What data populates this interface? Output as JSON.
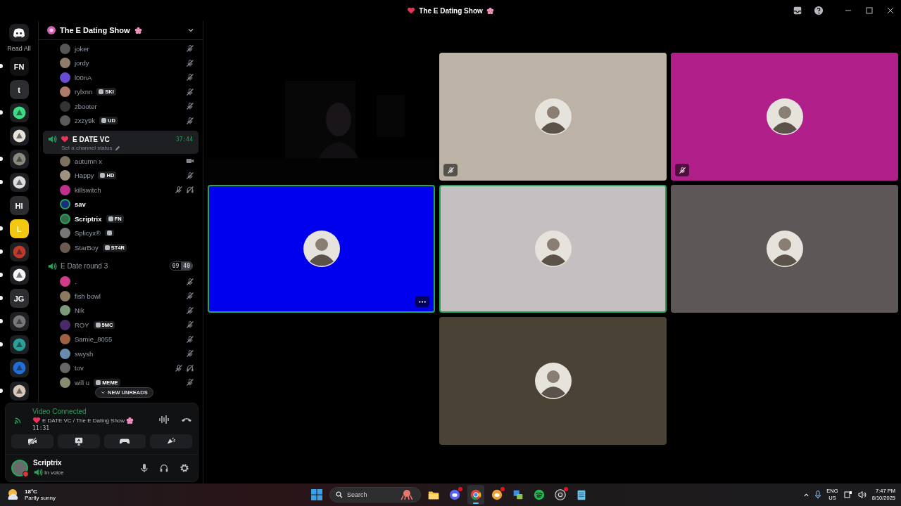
{
  "window": {
    "title": "The E Dating Show"
  },
  "rail": {
    "read_all": "Read All",
    "servers": [
      {
        "kind": "label",
        "label": "FN",
        "color": "#111111",
        "unread": true
      },
      {
        "kind": "label",
        "label": "t",
        "color": "#2b2d31",
        "unread": false
      },
      {
        "kind": "logo",
        "color": "#3ddc84",
        "unread": true
      },
      {
        "kind": "logo",
        "color": "#e8e2d8",
        "unread": false
      },
      {
        "kind": "logo",
        "color": "#8a8a80",
        "unread": true
      },
      {
        "kind": "logo",
        "color": "#dddddd",
        "unread": true
      },
      {
        "kind": "label",
        "label": "HI",
        "color": "#2b2d31",
        "unread": false
      },
      {
        "kind": "label",
        "label": "L",
        "color": "#f2c811",
        "unread": true
      },
      {
        "kind": "logo",
        "color": "#c0392b",
        "unread": true
      },
      {
        "kind": "logo",
        "color": "#f5f5f5",
        "unread": true
      },
      {
        "kind": "label",
        "label": "JG",
        "color": "#2b2d31",
        "unread": true
      },
      {
        "kind": "logo",
        "color": "#777777",
        "unread": true
      },
      {
        "kind": "logo",
        "color": "#2aa198",
        "unread": true
      },
      {
        "kind": "logo",
        "color": "#1e6fd9",
        "unread": false
      },
      {
        "kind": "logo",
        "color": "#d9c7b8",
        "unread": true
      }
    ]
  },
  "server": {
    "name": "The E Dating Show"
  },
  "members_above": [
    {
      "name": "joker",
      "muted": true
    },
    {
      "name": "jordy",
      "muted": true
    },
    {
      "name": "l00nA",
      "muted": true
    },
    {
      "name": "rylxnn",
      "tag": "SKI",
      "muted": true
    },
    {
      "name": "zbooter",
      "muted": true
    },
    {
      "name": "zxzy9k",
      "tag": "UD",
      "muted": true
    }
  ],
  "channels": [
    {
      "name": "E DATE VC",
      "selected": true,
      "timer": "37:44",
      "status": "Set a channel status",
      "members": [
        {
          "name": "autumn x",
          "video": true
        },
        {
          "name": "Happy",
          "tag": "HD",
          "muted": true
        },
        {
          "name": "killswitch",
          "muted": true,
          "deafened": true
        },
        {
          "name": "sav",
          "speaking": true
        },
        {
          "name": "Scriptrix",
          "tag": "FN",
          "speaking": true
        },
        {
          "name": "Splicyx®",
          "tag_icon_only": true
        },
        {
          "name": "StarBoy",
          "tag": "ST4R"
        }
      ]
    },
    {
      "name": "E Date round 3",
      "selected": false,
      "user_count": "09",
      "user_limit": "40",
      "members": [
        {
          "name": ".",
          "muted": true
        },
        {
          "name": "fish bowl",
          "muted": true
        },
        {
          "name": "Nik",
          "muted": true
        },
        {
          "name": "ROY",
          "tag": "5MC",
          "muted": true
        },
        {
          "name": "Samie_8055",
          "muted": true
        },
        {
          "name": "swysh",
          "muted": true
        },
        {
          "name": "tov",
          "muted": true,
          "deafened": true
        },
        {
          "name": "will u",
          "tag": "MEME",
          "muted": true
        }
      ]
    }
  ],
  "new_unreads": "NEW UNREADS",
  "voice_panel": {
    "status": "Video Connected",
    "location": "E DATE VC / The E Dating Show",
    "elapsed": "11:31"
  },
  "user_panel": {
    "name": "Scriptrix",
    "status": "In voice"
  },
  "tiles": [
    {
      "kind": "video"
    },
    {
      "kind": "avatar",
      "color": "#bcb3a6",
      "muted": true
    },
    {
      "kind": "avatar",
      "color": "#b01f8a",
      "muted": true
    },
    {
      "kind": "avatar",
      "color": "#0000ee",
      "speaking": true,
      "menu": true
    },
    {
      "kind": "avatar",
      "color": "#c4bfc0",
      "speaking": true
    },
    {
      "kind": "avatar",
      "color": "#5d5757"
    },
    {
      "kind": "avatar",
      "color": "#4a4235"
    }
  ],
  "taskbar": {
    "weather": {
      "temp": "18°C",
      "condition": "Partly sunny"
    },
    "search": {
      "placeholder": "Search"
    },
    "apps": [
      {
        "kind": "folder",
        "active": false,
        "badge": false
      },
      {
        "kind": "chat",
        "active": false,
        "badge": true
      },
      {
        "kind": "browser",
        "active": true,
        "badge": false
      },
      {
        "kind": "chat2",
        "active": false,
        "badge": true
      },
      {
        "kind": "lock",
        "active": false,
        "badge": false
      },
      {
        "kind": "music",
        "active": false,
        "badge": false
      },
      {
        "kind": "record",
        "active": false,
        "badge": true
      },
      {
        "kind": "notepad",
        "active": false,
        "badge": false
      }
    ],
    "tray": {
      "lang": "ENG",
      "region": "US",
      "time": "7:47 PM",
      "date": "8/10/2025"
    }
  }
}
